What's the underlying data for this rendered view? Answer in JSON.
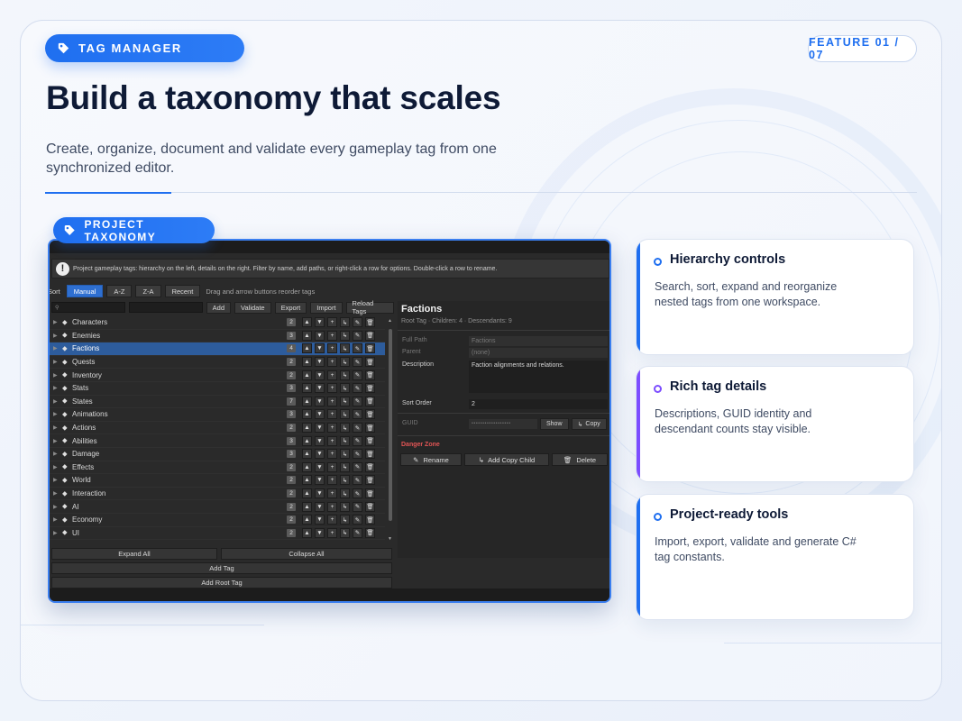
{
  "header": {
    "pill_label": "TAG MANAGER",
    "feature_counter": "FEATURE 01 / 07",
    "title": "Build a taxonomy that scales",
    "subtitle": "Create, organize, document and validate every gameplay tag from one synchronized editor."
  },
  "section_pill": "PROJECT TAXONOMY",
  "editor": {
    "info_text": "Project gameplay tags: hierarchy on the left, details on the right. Filter by name, add paths, or right-click a row for options. Double-click a row to rename.",
    "sort_label": "Sort",
    "sort_options": [
      "Manual",
      "A-Z",
      "Z-A",
      "Recent"
    ],
    "sort_selected": "Manual",
    "sort_hint": "Drag and arrow buttons reorder tags",
    "toolbar": [
      "Add",
      "Validate",
      "Export",
      "Import",
      "Reload Tags"
    ],
    "tags": [
      {
        "name": "Characters",
        "count": "2"
      },
      {
        "name": "Enemies",
        "count": "3"
      },
      {
        "name": "Factions",
        "count": "4",
        "selected": true
      },
      {
        "name": "Quests",
        "count": "2"
      },
      {
        "name": "Inventory",
        "count": "2"
      },
      {
        "name": "Stats",
        "count": "3"
      },
      {
        "name": "States",
        "count": "7"
      },
      {
        "name": "Animations",
        "count": "3"
      },
      {
        "name": "Actions",
        "count": "2"
      },
      {
        "name": "Abilities",
        "count": "3"
      },
      {
        "name": "Damage",
        "count": "3"
      },
      {
        "name": "Effects",
        "count": "2"
      },
      {
        "name": "World",
        "count": "2"
      },
      {
        "name": "Interaction",
        "count": "2"
      },
      {
        "name": "AI",
        "count": "2"
      },
      {
        "name": "Economy",
        "count": "2"
      },
      {
        "name": "UI",
        "count": "2"
      }
    ],
    "expand_all": "Expand All",
    "collapse_all": "Collapse All",
    "add_tag": "Add Tag",
    "add_root_tag": "Add Root Tag",
    "detail": {
      "title": "Factions",
      "meta": "Root Tag · Children: 4 · Descendants: 9",
      "full_path_label": "Full Path",
      "full_path_value": "Factions",
      "parent_label": "Parent",
      "parent_value": "(none)",
      "description_label": "Description",
      "description_value": "Faction alignments and relations.",
      "sort_order_label": "Sort Order",
      "sort_order_value": "2",
      "guid_label": "GUID",
      "guid_value": "••••••••••••••••••",
      "show_label": "Show",
      "copy_label": "Copy",
      "danger_zone": "Danger Zone",
      "rename_label": "Rename",
      "add_copy_child_label": "Add Copy Child",
      "delete_label": "Delete"
    }
  },
  "features": [
    {
      "title": "Hierarchy controls",
      "text": "Search, sort, expand and reorganize nested tags from one workspace.",
      "accent": "#1f6ff0"
    },
    {
      "title": "Rich tag details",
      "text": "Descriptions, GUID identity and descendant counts stay visible.",
      "accent": "#7c4dff"
    },
    {
      "title": "Project-ready tools",
      "text": "Import, export, validate and generate C# tag constants.",
      "accent": "#1f6ff0"
    }
  ],
  "colors": {
    "accent_blue": "#1f6ff0",
    "accent_purple": "#7c4dff",
    "selection": "#2d5c9c",
    "danger": "#e25555"
  }
}
